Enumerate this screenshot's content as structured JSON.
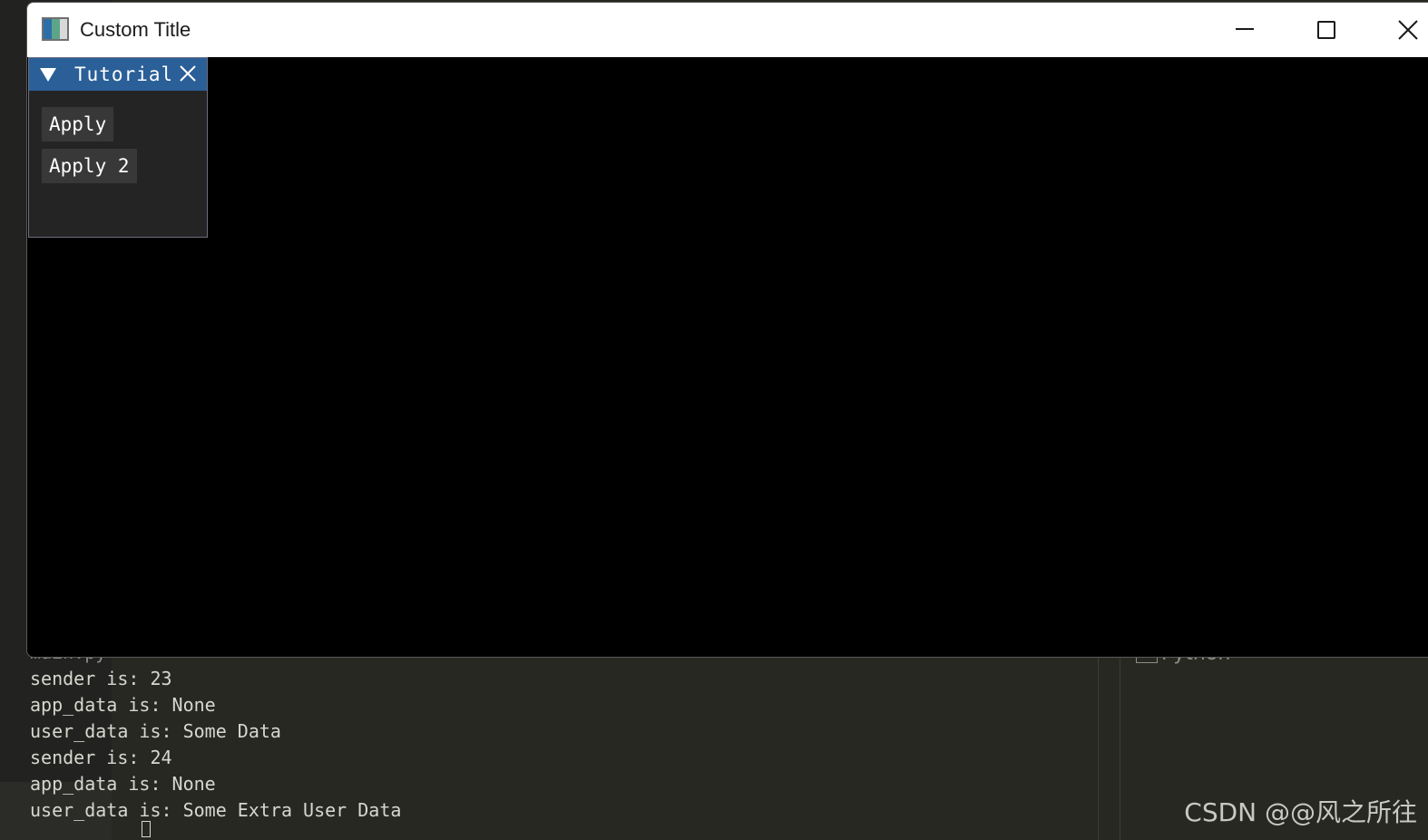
{
  "window": {
    "title": "Custom Title",
    "controls": {
      "minimize_icon": "minimize-icon",
      "maximize_icon": "maximize-icon",
      "close_icon": "close-icon"
    }
  },
  "imgui_window": {
    "title": "Tutorial",
    "buttons": [
      {
        "label": "Apply"
      },
      {
        "label": "Apply 2"
      }
    ],
    "colors": {
      "titlebar": "#2a5f98",
      "background": "#242424",
      "button": "#383838"
    }
  },
  "terminal": {
    "partial_line": "main.py",
    "lines": [
      "sender is: 23",
      "app_data is: None",
      "user_data is: Some Data",
      "sender is: 24",
      "app_data is: None",
      "user_data is: Some Extra User Data"
    ]
  },
  "side_panel": {
    "language_label": "Python"
  },
  "watermark": "CSDN @@风之所往"
}
